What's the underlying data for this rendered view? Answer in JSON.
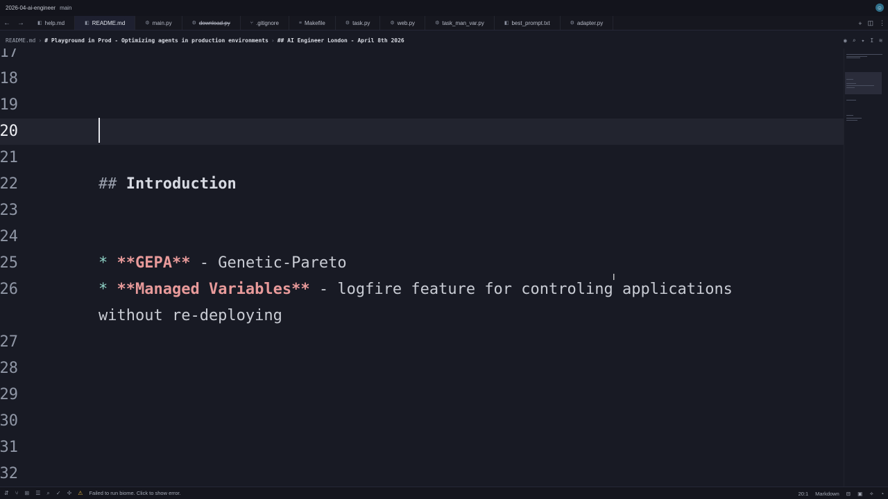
{
  "window": {
    "title": "2026-04-ai-engineer",
    "branch": "main"
  },
  "tabs": [
    {
      "label": "help.md",
      "icon": "book-icon",
      "active": false,
      "deleted": false
    },
    {
      "label": "README.md",
      "icon": "book-icon",
      "active": true,
      "deleted": false
    },
    {
      "label": "main.py",
      "icon": "python-icon",
      "active": false,
      "deleted": false
    },
    {
      "label": "download.py",
      "icon": "python-icon",
      "active": false,
      "deleted": true
    },
    {
      "label": ".gitignore",
      "icon": "git-icon",
      "active": false,
      "deleted": false
    },
    {
      "label": "Makefile",
      "icon": "file-icon",
      "active": false,
      "deleted": false
    },
    {
      "label": "task.py",
      "icon": "python-icon",
      "active": false,
      "deleted": false
    },
    {
      "label": "web.py",
      "icon": "python-icon",
      "active": false,
      "deleted": false
    },
    {
      "label": "task_man_var.py",
      "icon": "python-icon",
      "active": false,
      "deleted": false
    },
    {
      "label": "best_prompt.txt",
      "icon": "book-icon",
      "active": false,
      "deleted": false
    },
    {
      "label": "adapter.py",
      "icon": "python-icon",
      "active": false,
      "deleted": false
    }
  ],
  "breadcrumb": {
    "file": "README.md",
    "h1": "# Playground in Prod - Optimizing agents in production environments",
    "h2": "## AI Engineer London - April 8th 2026"
  },
  "editor": {
    "lines": [
      {
        "num": "17",
        "text": ""
      },
      {
        "num": "18",
        "text": ""
      },
      {
        "num": "19",
        "text": ""
      },
      {
        "num": "20",
        "text": ""
      },
      {
        "num": "21",
        "text": ""
      },
      {
        "num": "22",
        "hash": "##",
        "heading": "Introduction"
      },
      {
        "num": "23",
        "text": ""
      },
      {
        "num": "24",
        "text": ""
      },
      {
        "num": "25",
        "star": "*",
        "bold": "**GEPA**",
        "rest": " - Genetic-Pareto"
      },
      {
        "num": "26",
        "star": "*",
        "bold": "**Managed Variables**",
        "rest": " - logfire feature for controling applications",
        "wrap": "without re-deploying"
      },
      {
        "num": "27",
        "text": ""
      },
      {
        "num": "28",
        "text": ""
      },
      {
        "num": "29",
        "text": ""
      },
      {
        "num": "30",
        "text": ""
      },
      {
        "num": "31",
        "text": ""
      },
      {
        "num": "32",
        "text": ""
      }
    ],
    "current_line": "20"
  },
  "statusbar": {
    "message": "Failed to run biome. Click to show error.",
    "position": "20:1",
    "language": "Markdown"
  },
  "colors": {
    "background": "#181a24",
    "heading": "#d7dae2",
    "bold_text": "#e89a9a",
    "bullet": "#8fd3c7",
    "warning": "#e3b341"
  }
}
